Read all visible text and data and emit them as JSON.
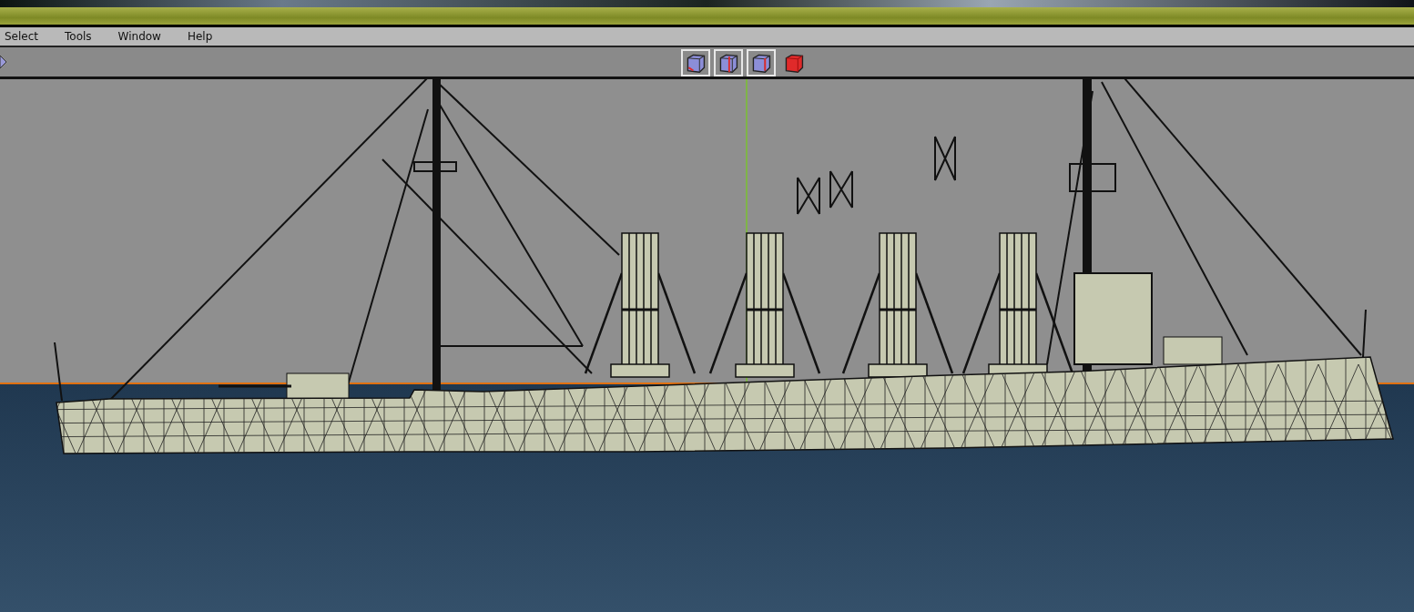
{
  "menu": [
    {
      "label": "Select"
    },
    {
      "label": "Tools"
    },
    {
      "label": "Window"
    },
    {
      "label": "Help"
    }
  ],
  "view_buttons": [
    {
      "kind": "wireframe",
      "selected": true
    },
    {
      "kind": "wireframe",
      "selected": true
    },
    {
      "kind": "wireframe",
      "selected": true
    },
    {
      "kind": "solid",
      "selected": false
    }
  ]
}
